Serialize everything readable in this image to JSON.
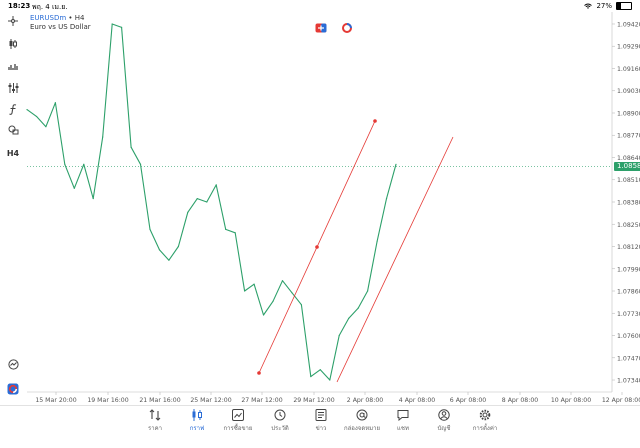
{
  "status": {
    "time": "18:23",
    "date": "พฤ. 4 เม.ย.",
    "battery": "27%",
    "battery_level": 0.27
  },
  "symbol": {
    "name": "EURUSDm",
    "timeframe": "• H4",
    "description": "Euro vs US Dollar"
  },
  "toolbar": {
    "items": [
      {
        "icon": "crosshair-icon"
      },
      {
        "icon": "candle-type-icon"
      },
      {
        "icon": "volume-icon"
      },
      {
        "icon": "indicators-icon"
      },
      {
        "icon": "function-icon"
      },
      {
        "icon": "objects-icon"
      },
      {
        "icon": "timeframe-label",
        "label": "H4"
      }
    ],
    "bottom": [
      {
        "icon": "trade-history-icon"
      },
      {
        "icon": "one-click-trading-icon"
      }
    ]
  },
  "top_icons": [
    {
      "icon": "trade-panel-icon"
    },
    {
      "icon": "account-icon"
    }
  ],
  "chart": {
    "current_price": "1.08587",
    "colors": {
      "line": "#2da06a",
      "channel": "#e53935",
      "grid_dot": "#2da06a"
    },
    "y_ticks": [
      "1.09420",
      "1.09290",
      "1.09160",
      "1.09030",
      "1.08900",
      "1.08770",
      "1.08640",
      "1.08510",
      "1.08380",
      "1.08250",
      "1.08120",
      "1.07990",
      "1.07860",
      "1.07730",
      "1.07600",
      "1.07470",
      "1.07340"
    ],
    "x_ticks": [
      "15 Mar 20:00",
      "19 Mar 16:00",
      "21 Mar 16:00",
      "25 Mar 12:00",
      "27 Mar 12:00",
      "29 Mar 12:00",
      "2 Apr 08:00",
      "4 Apr 08:00",
      "6 Apr 08:00",
      "8 Apr 08:00",
      "10 Apr 08:00",
      "12 Apr 08:00"
    ]
  },
  "chart_data": {
    "type": "line",
    "title": "",
    "xlabel": "",
    "ylabel": "",
    "ylim": [
      1.0727,
      1.0949
    ],
    "x": [
      "15 Mar 04:00",
      "15 Mar 12:00",
      "15 Mar 20:00",
      "18 Mar 04:00",
      "18 Mar 12:00",
      "18 Mar 20:00",
      "19 Mar 04:00",
      "19 Mar 12:00",
      "19 Mar 16:00",
      "19 Mar 20:00",
      "20 Mar 04:00",
      "20 Mar 12:00",
      "20 Mar 20:00",
      "21 Mar 04:00",
      "21 Mar 16:00",
      "22 Mar 04:00",
      "22 Mar 12:00",
      "25 Mar 04:00",
      "25 Mar 12:00",
      "25 Mar 20:00",
      "26 Mar 04:00",
      "26 Mar 12:00",
      "27 Mar 04:00",
      "27 Mar 12:00",
      "27 Mar 20:00",
      "28 Mar 04:00",
      "28 Mar 12:00",
      "28 Mar 20:00",
      "29 Mar 04:00",
      "29 Mar 12:00",
      "1 Apr 04:00",
      "1 Apr 12:00",
      "1 Apr 20:00",
      "2 Apr 04:00",
      "2 Apr 08:00",
      "2 Apr 16:00",
      "3 Apr 04:00",
      "3 Apr 12:00",
      "3 Apr 20:00",
      "4 Apr 04:00"
    ],
    "values": [
      1.0892,
      1.0888,
      1.0882,
      1.0896,
      1.086,
      1.0846,
      1.086,
      1.084,
      1.0876,
      1.0942,
      1.094,
      1.087,
      1.086,
      1.0822,
      1.081,
      1.0804,
      1.0812,
      1.0832,
      1.084,
      1.0838,
      1.0848,
      1.0822,
      1.082,
      1.0786,
      1.079,
      1.0772,
      1.078,
      1.0792,
      1.0785,
      1.0778,
      1.0736,
      1.074,
      1.0734,
      1.076,
      1.077,
      1.0776,
      1.0786,
      1.0815,
      1.084,
      1.086
    ],
    "series": [
      {
        "name": "EURUSDm",
        "values": [
          1.0892,
          1.0888,
          1.0882,
          1.0896,
          1.086,
          1.0846,
          1.086,
          1.084,
          1.0876,
          1.0942,
          1.094,
          1.087,
          1.086,
          1.0822,
          1.081,
          1.0804,
          1.0812,
          1.0832,
          1.084,
          1.0838,
          1.0848,
          1.0822,
          1.082,
          1.0786,
          1.079,
          1.0772,
          1.078,
          1.0792,
          1.0785,
          1.0778,
          1.0736,
          1.074,
          1.0734,
          1.076,
          1.077,
          1.0776,
          1.0786,
          1.0815,
          1.084,
          1.086
        ]
      }
    ],
    "current_price": 1.08587,
    "grid": false
  },
  "nav": {
    "items": [
      {
        "label": "ราคา",
        "icon": "quotes-icon",
        "active": false
      },
      {
        "label": "กราฟ",
        "icon": "chart-icon",
        "active": true
      },
      {
        "label": "การซื้อขาย",
        "icon": "trade-icon",
        "active": false
      },
      {
        "label": "ประวัติ",
        "icon": "history-icon",
        "active": false
      },
      {
        "label": "ข่าว",
        "icon": "news-icon",
        "active": false
      },
      {
        "label": "กล่องจดหมาย",
        "icon": "mailbox-icon",
        "active": false
      },
      {
        "label": "แชท",
        "icon": "chat-icon",
        "active": false
      },
      {
        "label": "บัญชี",
        "icon": "account-icon",
        "active": false
      },
      {
        "label": "การตั้งค่า",
        "icon": "settings-icon",
        "active": false
      }
    ]
  }
}
